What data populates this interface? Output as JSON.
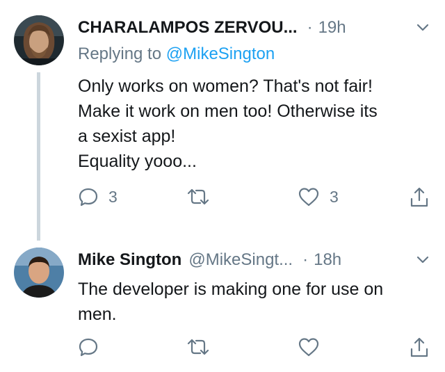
{
  "tweets": [
    {
      "name": "CHARALAMPOS ZERVOU...",
      "handle": "",
      "time": "19h",
      "reply_prefix": "Replying to",
      "reply_mention": "@MikeSington",
      "body_lines": [
        "Only works on women? That's not fair!",
        "Make it work on men too! Otherwise its",
        "a sexist app!",
        "Equality yooo..."
      ],
      "reply_count": "3",
      "retweet_count": "",
      "like_count": "3"
    },
    {
      "name": "Mike Sington",
      "handle": "@MikeSingt...",
      "time": "18h",
      "body_lines": [
        "The developer is making one for use on",
        "men."
      ],
      "reply_count": "",
      "retweet_count": "",
      "like_count": ""
    }
  ],
  "separator": "·",
  "icons": [
    "reply-icon",
    "retweet-icon",
    "like-icon",
    "share-icon",
    "chevron-down-icon"
  ],
  "colors": {
    "text": "#14171a",
    "secondary": "#657786",
    "link": "#1da1f2",
    "thread_line": "#ccd6dd"
  }
}
